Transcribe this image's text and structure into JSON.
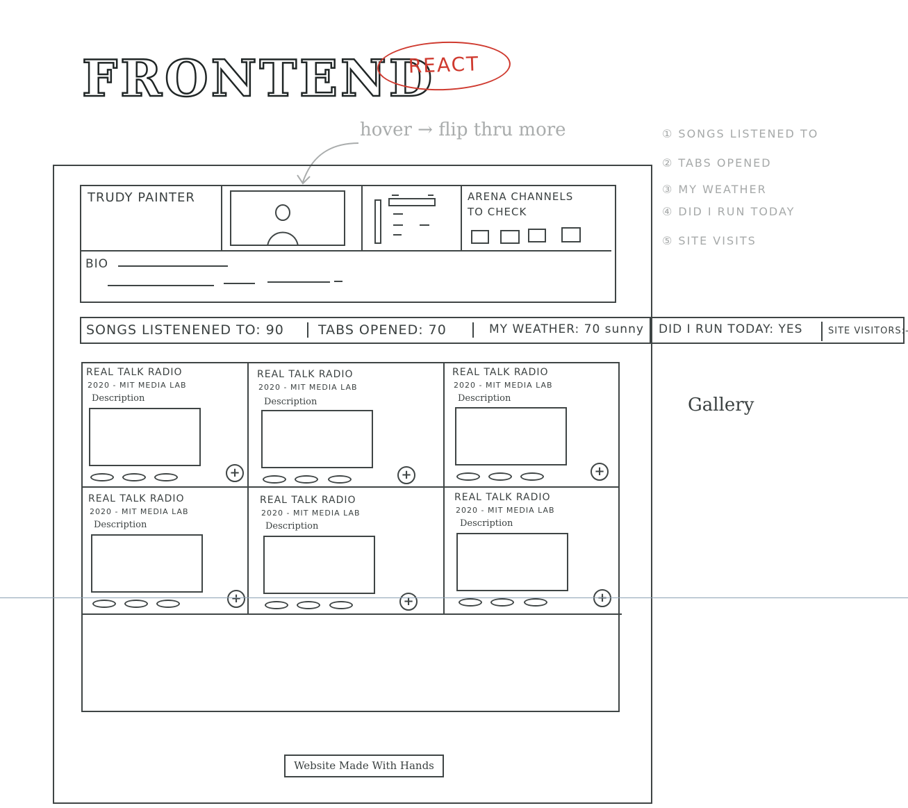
{
  "header": {
    "title": "FRONTEND",
    "framework_badge": "REACT",
    "hover_note": "hover → flip thru more"
  },
  "feature_list": [
    "① SONGS LISTENED TO",
    "② TABS OPENED",
    "③ MY WEATHER",
    "④ DID I RUN TODAY",
    "⑤ SITE VISITS"
  ],
  "profile": {
    "name": "TRUDY PAINTER",
    "channels_label_line1": "ARENA CHANNELS",
    "channels_label_line2": "TO CHECK",
    "bio_label": "BIO"
  },
  "stats_bar": {
    "songs": "SONGS LISTENENED TO: 90",
    "tabs": "TABS OPENED: 70",
    "weather": "MY WEATHER: 70 sunny",
    "run": "DID I RUN TODAY: YES",
    "visits": "SITE VISITORS:-"
  },
  "gallery": {
    "side_label": "Gallery",
    "cards": [
      {
        "title": "REAL TALK RADIO",
        "subtitle": "2020 - MIT MEDIA LAB",
        "desc": "Description"
      },
      {
        "title": "REAL TALK RADIO",
        "subtitle": "2020 - MIT MEDIA LAB",
        "desc": "Description"
      },
      {
        "title": "REAL TALK RADIO",
        "subtitle": "2020 - MIT MEDIA LAB",
        "desc": "Description"
      },
      {
        "title": "REAL TALK RADIO",
        "subtitle": "2020 - MIT MEDIA LAB",
        "desc": "Description"
      },
      {
        "title": "REAL TALK RADIO",
        "subtitle": "2020 - MIT MEDIA LAB",
        "desc": "Description"
      },
      {
        "title": "REAL TALK RADIO",
        "subtitle": "2020 - MIT MEDIA LAB",
        "desc": "Description"
      }
    ]
  },
  "footer": {
    "label": "Website Made With Hands"
  },
  "colors": {
    "ink": "#3f4545",
    "react_red": "#cf3a2f",
    "pencil_gray": "#a6a9a9"
  }
}
